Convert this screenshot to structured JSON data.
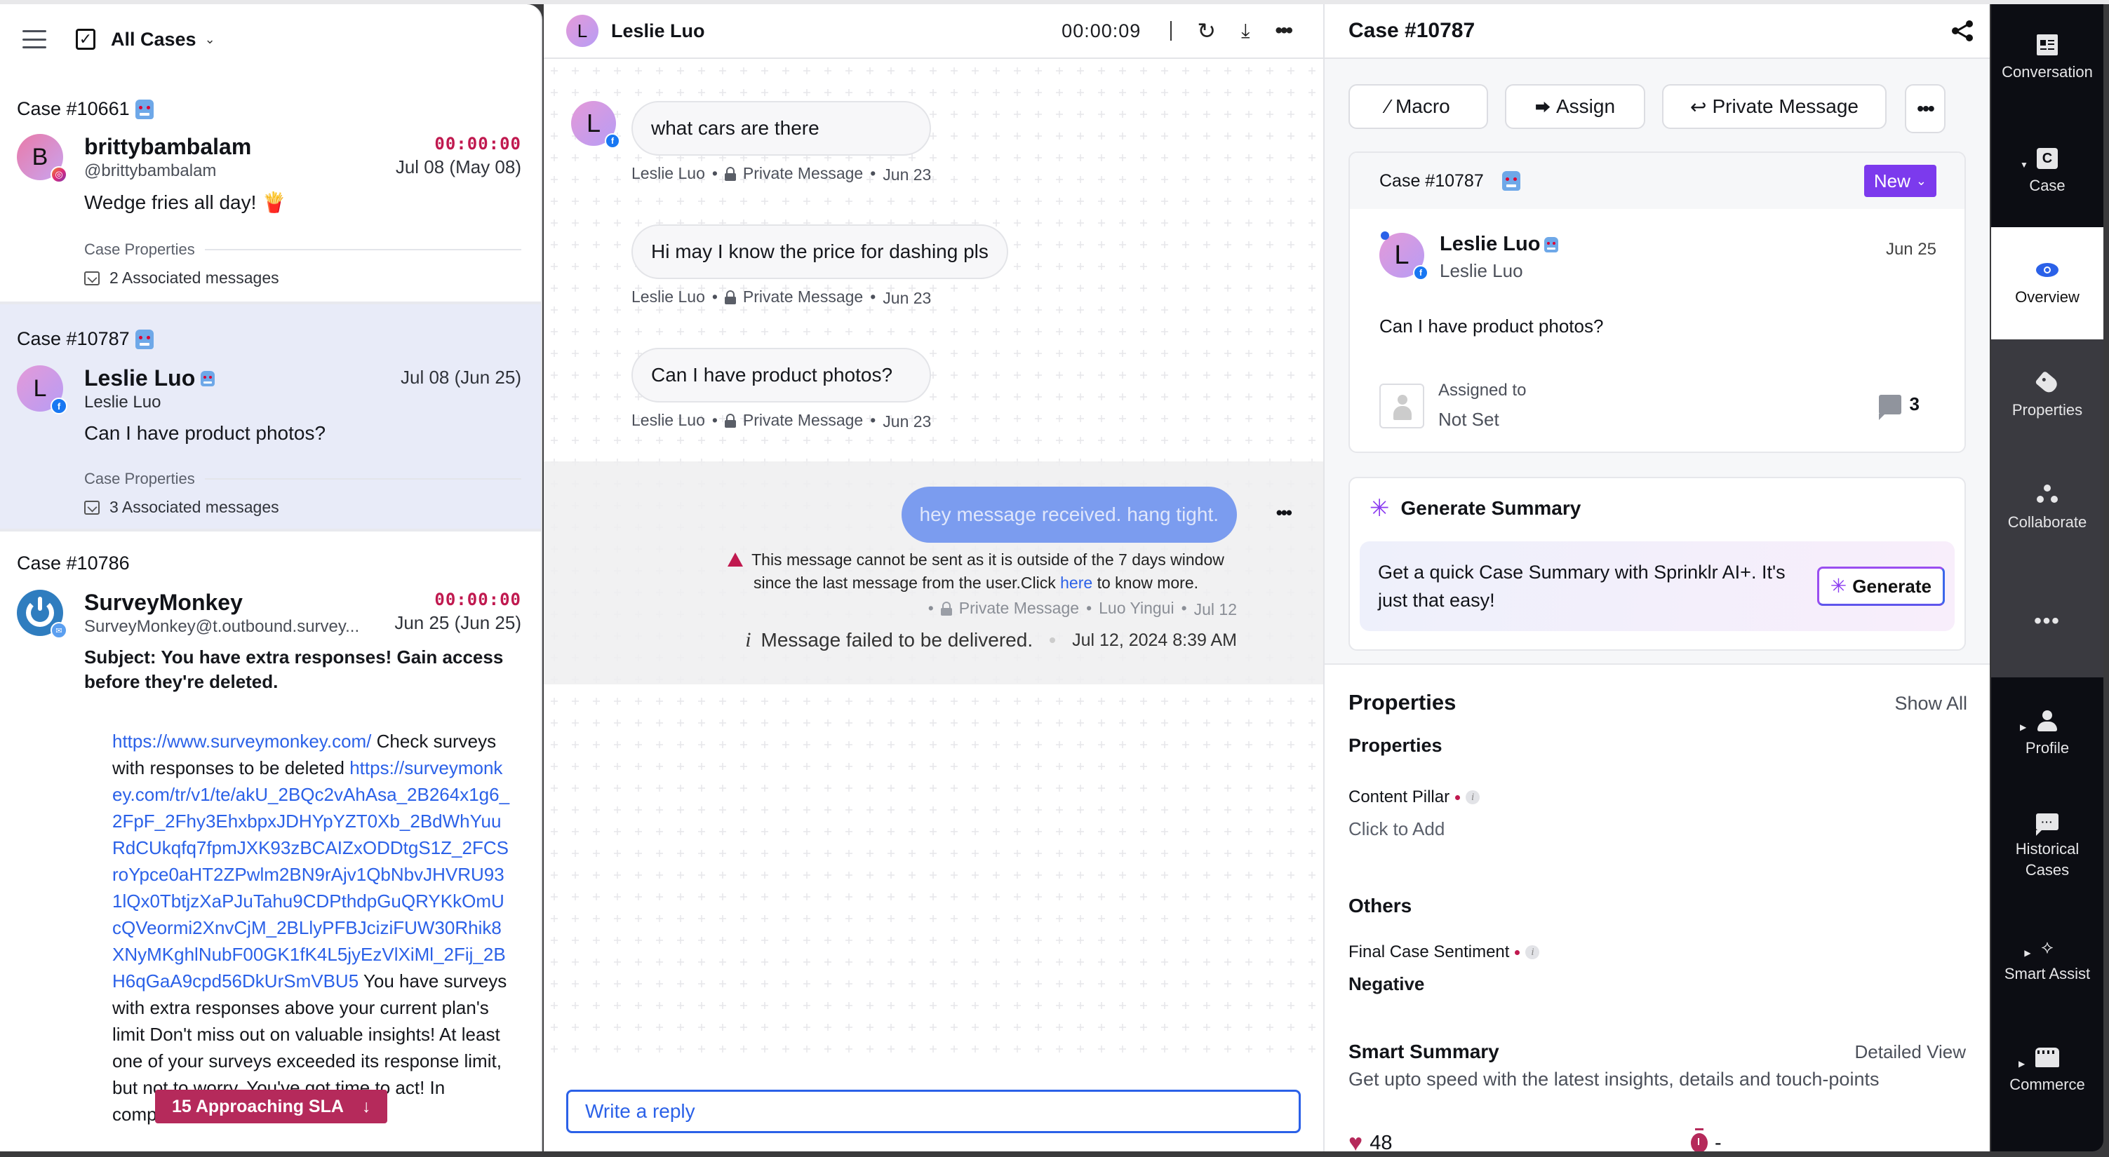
{
  "case_list": {
    "header": {
      "filter_label": "All Cases"
    },
    "cases": [
      {
        "case_id": "Case #10661",
        "bot_badge": true,
        "avatar_letter": "B",
        "channel": "instagram",
        "name": "brittybambalam",
        "handle": "@brittybambalam",
        "sla_timer": "00:00:00",
        "date": "Jul 08 (May 08)",
        "message": "Wedge fries all day! 🍟",
        "properties_label": "Case Properties",
        "associated": "2 Associated messages",
        "selected": false
      },
      {
        "case_id": "Case #10787",
        "bot_badge": true,
        "avatar_letter": "L",
        "channel": "facebook",
        "name": "Leslie Luo",
        "handle": "Leslie Luo",
        "sla_timer": "",
        "date": "Jul 08 (Jun 25)",
        "message": "Can I have product photos?",
        "properties_label": "Case Properties",
        "associated": "3 Associated messages",
        "selected": true
      },
      {
        "case_id": "Case #10786",
        "bot_badge": false,
        "avatar_letter": "",
        "channel": "email",
        "name": "SurveyMonkey",
        "handle": "SurveyMonkey@t.outbound.survey...",
        "sla_timer": "00:00:00",
        "date": "Jun 25 (Jun 25)",
        "subject": "Subject: You have extra responses! Gain access before they're deleted.",
        "body": {
          "link1": "https://www.surveymonkey.com/",
          "text1": " Check surveys with responses to be deleted ",
          "link2": "https://surveymonkey.com/tr/v1/te/akU_2BQc2vAhAsa_2B264x1g6_2FpF_2Fhy3EhxbpxJDHYpYZT0Xb_2BdWhYuuRdCUkqfq7fpmJXK93zBCAIZxODDtgS1Z_2FCSroYpce0aHT2ZPwlm2BN9rAjv1QbNbvJHVRU931lQx0TbtjzXaPJuTahu9CDPthdpGuQRYKkOmUcQVeormi2XnvCjM_2BLlyPFBJciziFUW30Rhik8XNyMKghlNubF00GK1fK4L5jyEzVlXiMl_2Fij_2BH6qGaA9cpd56DkUrSmVBU5",
          "text2": " You have surveys with extra responses above your current plan's limit Don't miss out on valuable insights! At least one of your surveys exceeded its response limit, but not to worry. You've got time to act! In compliance"
        },
        "selected": false
      }
    ],
    "sla_pill": {
      "label": "15 Approaching SLA",
      "arrow": "↓"
    }
  },
  "conversation": {
    "header": {
      "avatar_letter": "L",
      "name": "Leslie Luo",
      "timer": "00:00:09",
      "icons": [
        "refresh-icon",
        "scroll-to-top-icon",
        "more-icon"
      ]
    },
    "messages": [
      {
        "avatar_letter": "L",
        "text": "what cars are there",
        "author": "Leslie Luo",
        "type": "Private Message",
        "date": "Jun 23"
      },
      {
        "text": "Hi may I know the price for dashing pls",
        "author": "Leslie Luo",
        "type": "Private Message",
        "date": "Jun 23"
      },
      {
        "text": "Can I have product photos?",
        "author": "Leslie Luo",
        "type": "Private Message",
        "date": "Jun 23"
      }
    ],
    "outgoing": {
      "text": "hey message received. hang tight.",
      "warning_prefix": "This message cannot be sent as it is outside of the 7 days window since the last message from the user.Click ",
      "warning_link": "here",
      "warning_suffix": " to know more.",
      "type": "Private Message",
      "author": "Luo Yingui",
      "date": "Jul 12",
      "failed_text": "Message failed to be delivered.",
      "failed_time": "Jul 12, 2024 8:39 AM"
    },
    "reply": {
      "placeholder": "Write a reply"
    }
  },
  "case_detail": {
    "title": "Case #10787",
    "actions": {
      "macro": "Macro",
      "assign": "Assign",
      "private_message": "Private Message"
    },
    "card": {
      "case_id": "Case #10787",
      "status": "New",
      "avatar_letter": "L",
      "name": "Leslie Luo",
      "handle": "Leslie Luo",
      "date": "Jun 25",
      "message": "Can I have product photos?",
      "assigned_label": "Assigned to",
      "assigned_value": "Not Set",
      "comment_count": "3"
    },
    "generate_summary": {
      "title": "Generate Summary",
      "text": "Get a quick Case Summary with Sprinklr AI+. It's just that easy!",
      "button": "Generate"
    },
    "properties": {
      "title": "Properties",
      "show_all": "Show All",
      "group1_title": "Properties",
      "content_pillar_label": "Content Pillar",
      "content_pillar_value": "Click to Add",
      "group2_title": "Others",
      "sentiment_label": "Final Case Sentiment",
      "sentiment_value": "Negative"
    },
    "smart_summary": {
      "title": "Smart Summary",
      "detailed_view": "Detailed View",
      "subtitle": "Get upto speed with the latest insights, details and touch-points",
      "stat1_value": "48",
      "stat2_value": "-"
    }
  },
  "rail": {
    "items": [
      {
        "label": "Conversation",
        "icon": "conversation-icon"
      },
      {
        "label": "Case",
        "icon": "case-icon"
      },
      {
        "label": "Overview",
        "icon": "eye-icon",
        "active": true
      },
      {
        "label": "Properties",
        "icon": "tag-icon"
      },
      {
        "label": "Collaborate",
        "icon": "collaborate-icon"
      },
      {
        "label": "More",
        "icon": "more-icon"
      },
      {
        "label": "Profile",
        "icon": "profile-icon"
      },
      {
        "label": "Historical Cases",
        "icon": "chat-history-icon"
      },
      {
        "label": "Smart Assist",
        "icon": "smart-assist-icon"
      },
      {
        "label": "Commerce",
        "icon": "storefront-icon"
      }
    ]
  },
  "colors": {
    "accent_blue": "#2b61e8",
    "sla_red": "#c0194f",
    "sla_pill": "#b52a5b",
    "status_purple": "#7c3aed",
    "selected_row": "#e8ebf8",
    "outgoing_bubble": "#7b9cef",
    "rail_dark": "#0c0d13"
  }
}
